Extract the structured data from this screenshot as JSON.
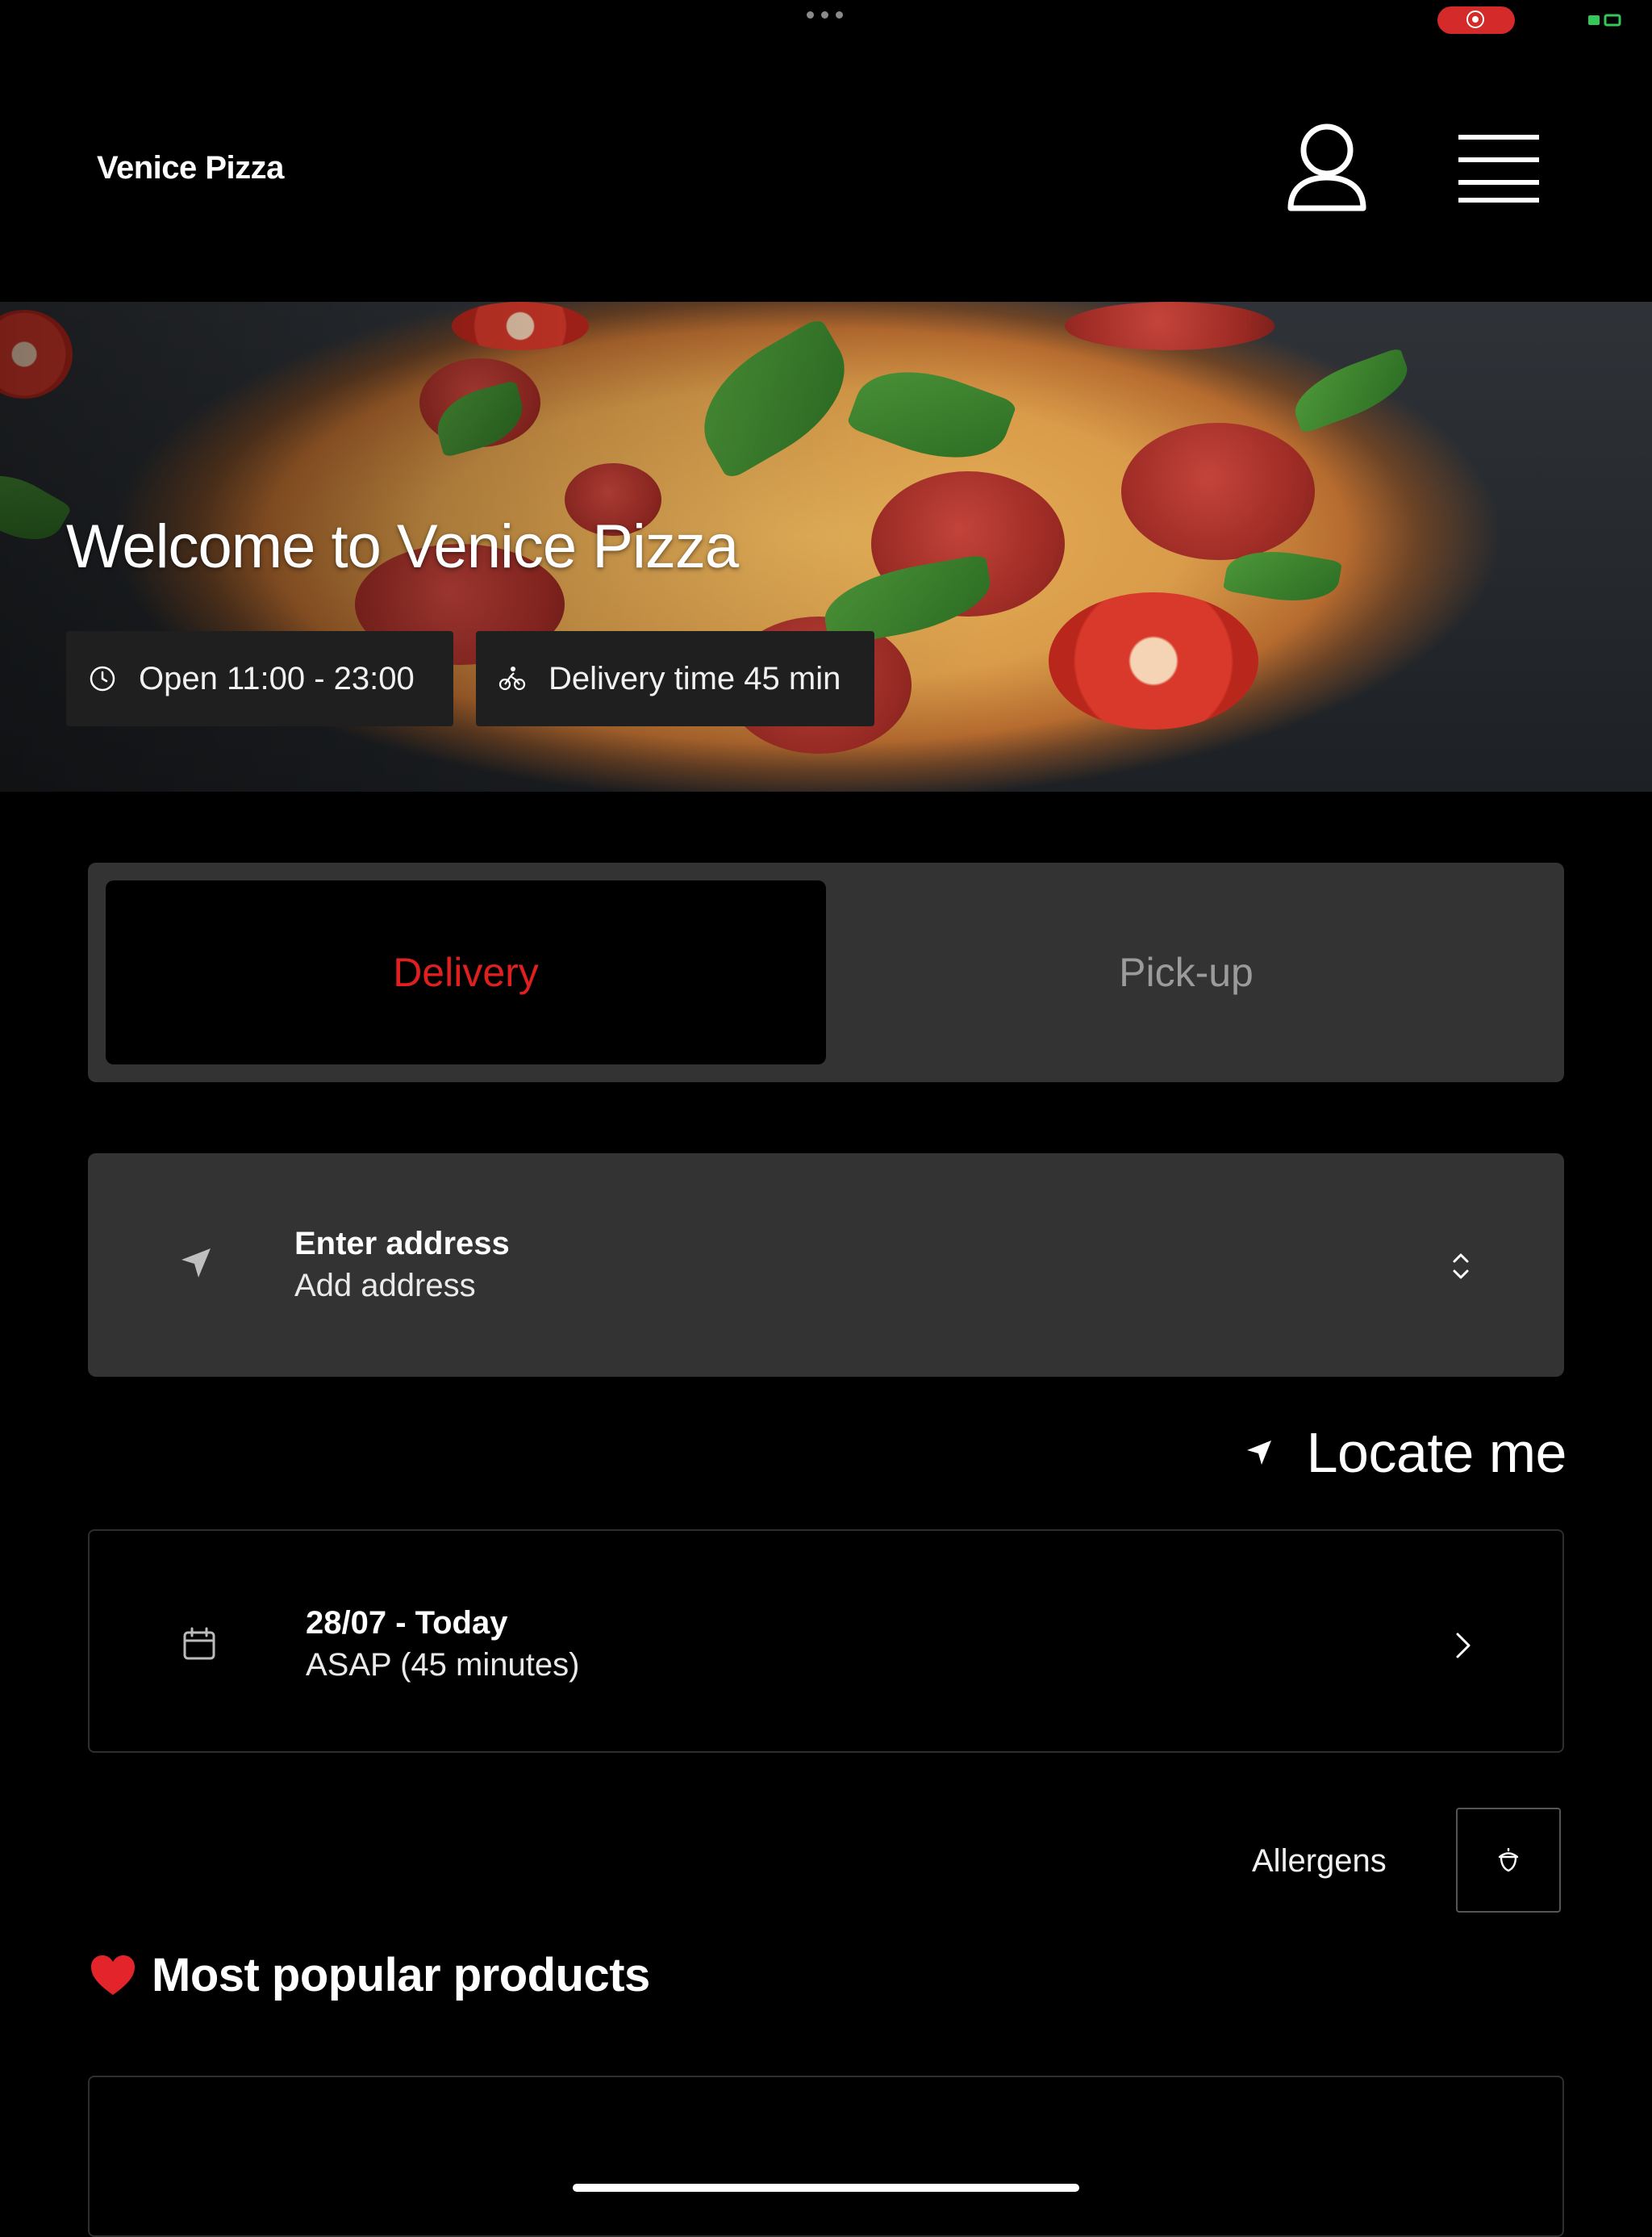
{
  "header": {
    "brand": "Venice Pizza",
    "icons": {
      "account": "person-icon",
      "menu": "hamburger-menu-icon"
    }
  },
  "hero": {
    "title": "Welcome to Venice Pizza",
    "chips": {
      "hours": {
        "icon": "clock-icon",
        "label": "Open 11:00 - 23:00"
      },
      "delivery_time": {
        "icon": "bicycle-icon",
        "label": "Delivery time 45 min"
      }
    }
  },
  "order_mode": {
    "options": [
      "Delivery",
      "Pick-up"
    ],
    "selected": "Delivery"
  },
  "address": {
    "icon": "navigation-arrow-icon",
    "title": "Enter address",
    "subtitle": "Add address"
  },
  "locate": {
    "icon": "location-arrow-icon",
    "label": "Locate me"
  },
  "schedule": {
    "icon": "calendar-icon",
    "title": "28/07 - Today",
    "subtitle": "ASAP (45 minutes)"
  },
  "allergens": {
    "label": "Allergens",
    "icon": "acorn-icon"
  },
  "popular": {
    "icon": "heart-icon",
    "title": "Most popular products"
  },
  "colors": {
    "accent": "#e01f1f",
    "card": "#333333",
    "background": "#000000",
    "recording": "#d42a2a"
  }
}
